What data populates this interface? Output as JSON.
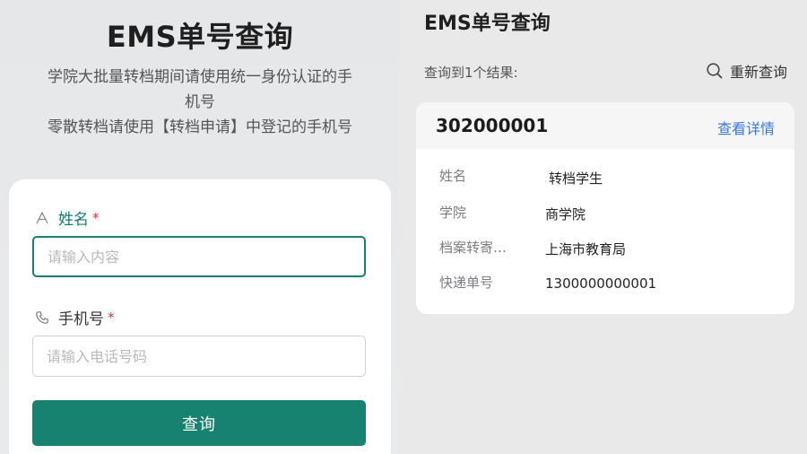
{
  "left": {
    "title": "EMS单号查询",
    "subtitle_line1": "学院大批量转档期间请使用统一身份认证的手",
    "subtitle_line2": "机号",
    "subtitle_line3": "零散转档请使用【转档申请】中登记的手机号",
    "form": {
      "name_label": "姓名",
      "name_required": "*",
      "name_placeholder": "请输入内容",
      "name_icon": "text-a-icon",
      "phone_label": "手机号",
      "phone_required": "*",
      "phone_placeholder": "请输入电话号码",
      "phone_icon": "phone-icon",
      "submit_label": "查询"
    }
  },
  "right": {
    "title": "EMS单号查询",
    "result_count": "查询到1个结果:",
    "requery_label": "重新查询",
    "requery_icon": "search-icon",
    "result": {
      "id": "302000001",
      "detail_link": "查看详情",
      "rows": [
        {
          "key": "姓名",
          "value": "转档学生"
        },
        {
          "key": "学院",
          "value": "商学院"
        },
        {
          "key": "档案转寄…",
          "value": "上海市教育局"
        },
        {
          "key": "快递单号",
          "value": "1300000000001"
        }
      ]
    }
  },
  "colors": {
    "accent": "#17826f",
    "required": "#d9363e",
    "link": "#3b78d8"
  }
}
